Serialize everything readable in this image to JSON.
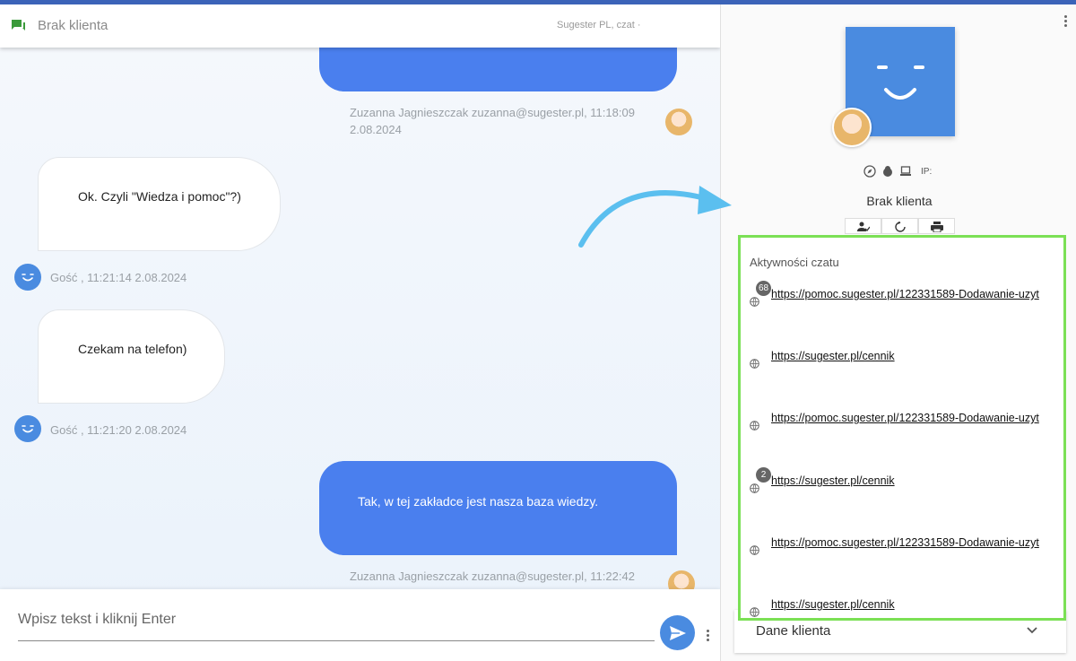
{
  "header": {
    "title": "Brak klienta",
    "subtitle": "Sugester PL, czat ·"
  },
  "messages": {
    "agent_meta_1a": "Zuzanna Jagnieszczak zuzanna@sugester.pl, 11:18:09",
    "agent_meta_1b": "2.08.2024",
    "guest_1": "Ok. Czyli \"Wiedza i pomoc\"?)",
    "guest_meta_1": "Gość , 11:21:14 2.08.2024",
    "guest_2": "Czekam na telefon)",
    "guest_meta_2": "Gość , 11:21:20 2.08.2024",
    "agent_2": "Tak, w tej zakładce jest nasza baza wiedzy.",
    "agent_meta_2": "Zuzanna Jagnieszczak zuzanna@sugester.pl, 11:22:42"
  },
  "composer": {
    "placeholder": "Wpisz tekst i kliknij Enter"
  },
  "profile": {
    "name": "Brak klienta",
    "ip_label": "IP:"
  },
  "activity": {
    "title": "Aktywności czatu",
    "items": [
      {
        "url": "https://pomoc.sugester.pl/122331589-Dodawanie-uzyt",
        "badge": "68"
      },
      {
        "url": "https://sugester.pl/cennik",
        "badge": ""
      },
      {
        "url": "https://pomoc.sugester.pl/122331589-Dodawanie-uzyt",
        "badge": ""
      },
      {
        "url": "https://sugester.pl/cennik",
        "badge": "2"
      },
      {
        "url": "https://pomoc.sugester.pl/122331589-Dodawanie-uzyt",
        "badge": ""
      },
      {
        "url": "https://sugester.pl/cennik",
        "badge": ""
      }
    ]
  },
  "client_data": {
    "label": "Dane klienta"
  },
  "colors": {
    "accent_blue": "#4a7fee",
    "highlight_green": "#7be055",
    "arrow_cyan": "#5bbfef"
  }
}
